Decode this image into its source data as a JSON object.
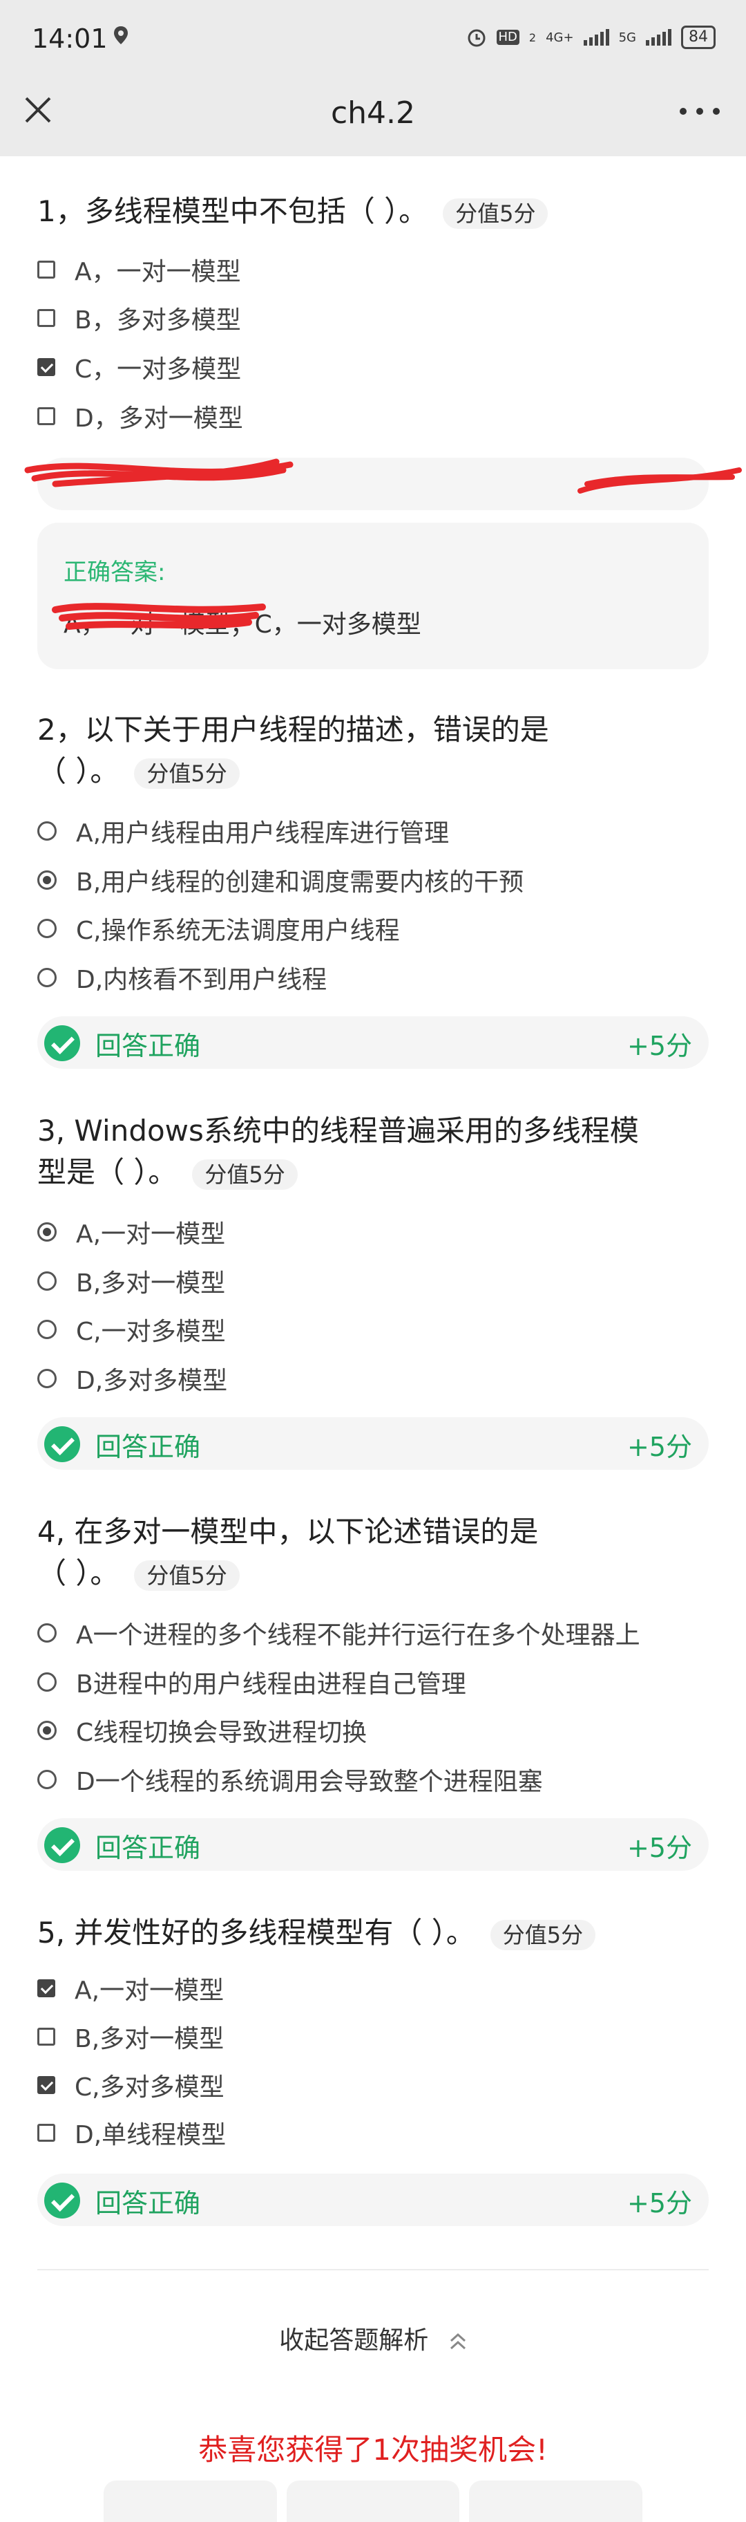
{
  "status_bar": {
    "time": "14:01",
    "hd": "HD",
    "hd_sub": "2",
    "net1": "4G+",
    "net2": "5G",
    "battery": "84"
  },
  "header": {
    "title": "ch4.2"
  },
  "questions": [
    {
      "title": "1，多线程模型中不包括（ ）。",
      "score": "分值5分",
      "type": "checkbox",
      "options": [
        {
          "label": "A，一对一模型",
          "checked": false
        },
        {
          "label": "B，多对多模型",
          "checked": false
        },
        {
          "label": "C，一对多模型",
          "checked": true
        },
        {
          "label": "D，多对一模型",
          "checked": false
        }
      ],
      "answer_label": "正确答案:",
      "answer_value": "A，一对一模型；C，一对多模型"
    },
    {
      "title_line1": "2，以下关于用户线程的描述，错误的是",
      "title_line2": "（ ）。",
      "score": "分值5分",
      "type": "radio",
      "options": [
        {
          "label": "A,用户线程由用户线程库进行管理",
          "checked": false
        },
        {
          "label": "B,用户线程的创建和调度需要内核的干预",
          "checked": true
        },
        {
          "label": "C,操作系统无法调度用户线程",
          "checked": false
        },
        {
          "label": "D,内核看不到用户线程",
          "checked": false
        }
      ],
      "result": "回答正确",
      "points": "+5分"
    },
    {
      "title_line1": "3, Windows系统中的线程普遍采用的多线程模",
      "title_line2": "型是（ ）。",
      "score": "分值5分",
      "type": "radio",
      "options": [
        {
          "label": "A,一对一模型",
          "checked": true
        },
        {
          "label": "B,多对一模型",
          "checked": false
        },
        {
          "label": "C,一对多模型",
          "checked": false
        },
        {
          "label": "D,多对多模型",
          "checked": false
        }
      ],
      "result": "回答正确",
      "points": "+5分"
    },
    {
      "title_line1": "4, 在多对一模型中，以下论述错误的是",
      "title_line2": "（ ）。",
      "score": "分值5分",
      "type": "radio",
      "options": [
        {
          "label": "A一个进程的多个线程不能并行运行在多个处理器上",
          "checked": false
        },
        {
          "label": "B进程中的用户线程由进程自己管理",
          "checked": false
        },
        {
          "label": "C线程切换会导致进程切换",
          "checked": true
        },
        {
          "label": "D一个线程的系统调用会导致整个进程阻塞",
          "checked": false
        }
      ],
      "result": "回答正确",
      "points": "+5分"
    },
    {
      "title": "5, 并发性好的多线程模型有（ ）。",
      "score": "分值5分",
      "type": "checkbox",
      "options": [
        {
          "label": "A,一对一模型",
          "checked": true
        },
        {
          "label": "B,多对一模型",
          "checked": false
        },
        {
          "label": "C,多对多模型",
          "checked": true
        },
        {
          "label": "D,单线程模型",
          "checked": false
        }
      ],
      "result": "回答正确",
      "points": "+5分"
    }
  ],
  "footer": {
    "collapse_label": "收起答题解析",
    "congrats": "恭喜您获得了1次抽奖机会!"
  },
  "colors": {
    "correct_green": "#1fa35f",
    "congrats_red": "#e02020",
    "scribble_red": "#e8282b"
  }
}
